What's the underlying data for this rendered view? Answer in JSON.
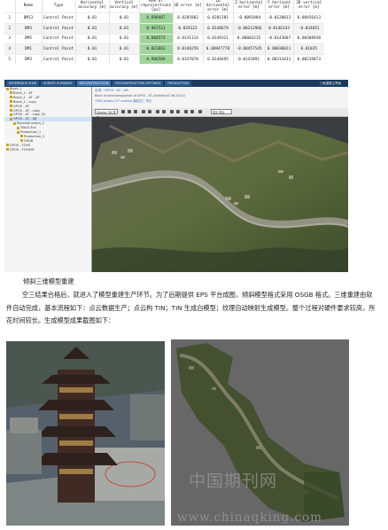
{
  "table": {
    "headers": [
      "",
      "Name",
      "Type",
      "Horizontal accuracy [m]",
      "Vertical accuracy [m]",
      "RMS of reprojections [px]",
      "3D error [m]",
      "2D horizontal error [m]",
      "Z horizontal error [m]",
      "Y horizont error [m]",
      "3D vertical error [m]"
    ],
    "rows": [
      [
        "1",
        "DM13",
        "Control Point",
        "0.01",
        "0.01",
        "0.698487",
        "0.0285882",
        "0.0201281",
        "-0.0093484",
        "-0.0120013",
        "0.00456413"
      ],
      [
        "2",
        "DM3",
        "Control Point",
        "0.01",
        "0.01",
        "0.967521",
        "0.029123",
        "0.0148679",
        "-0.00212966",
        "0.0146143",
        "-0.024851"
      ],
      [
        "3",
        "DM5",
        "Control Point",
        "0.01",
        "0.01",
        "0.604573",
        "0.0131114",
        "0.0149321",
        "0.00003215",
        "-0.0143007",
        "0.00308938"
      ],
      [
        "4",
        "DM1",
        "Control Point",
        "0.01",
        "0.01",
        "0.823863",
        "0.0140259",
        "0.00947778",
        "-0.00457545",
        "0.00830021",
        "0.01035"
      ],
      [
        "5",
        "DM3",
        "Control Point",
        "0.01",
        "0.01",
        "0.906589",
        "0.0147078",
        "0.0148495",
        "0.0142891",
        "0.00314431",
        "0.00219873"
      ]
    ]
  },
  "software": {
    "tabs": [
      "REFERENCE PLAN",
      "SURVEY SUMMARY",
      "RECONSTRUCTION",
      "RECONSTRUCTION SETTINGS",
      "PRODUCTION"
    ],
    "right_label": "三维建模主界面",
    "tree": [
      "Block_1",
      "Block_1 - AT",
      "Block_1 - AT - AT",
      "Block_1 - copy",
      "GPOS - AT",
      "GPOS - AT - copy",
      "GPOS - AT - copy (2)",
      "GPOS - AT - AB",
      "Reconstruction_1",
      "Tile/4-3x4",
      "Production_1",
      "Production_2",
      "OSGB",
      "GPOS - FOVS",
      "GPOS - FOVS/M"
    ],
    "path": "目录 › GPOS › AT › AB",
    "sub1": "Block of aerotriangulation of GPOS - AT (Untitled AT 06:25:42)",
    "sub2": "7264 photos   137 controls   重新空三   导出",
    "view_select": "Display 3D 视图",
    "view_select2": "显示 照片"
  },
  "heading": "倾斜三维模型重建",
  "paragraph": "空三结果合格后，就进入了模型重建生产环节。为了后期提供 EPS 平台成图，倾斜模型格式采用 OSGB 格式。三维重建由软件自动完成，基本流程如下：点云数据生产；点云构 TIN；TIN 生成白模型；纹理自动映射生成模型。整个过程对硬件要求较高，所花时间较长。生成模型成果截图如下：",
  "watermark": {
    "line1": "中国期刊网",
    "line2": "www.chinaqking.com"
  },
  "colors": {
    "highlight": "#9fd49a",
    "menubar": "#1b3a5c",
    "link": "#3a6fb0"
  }
}
